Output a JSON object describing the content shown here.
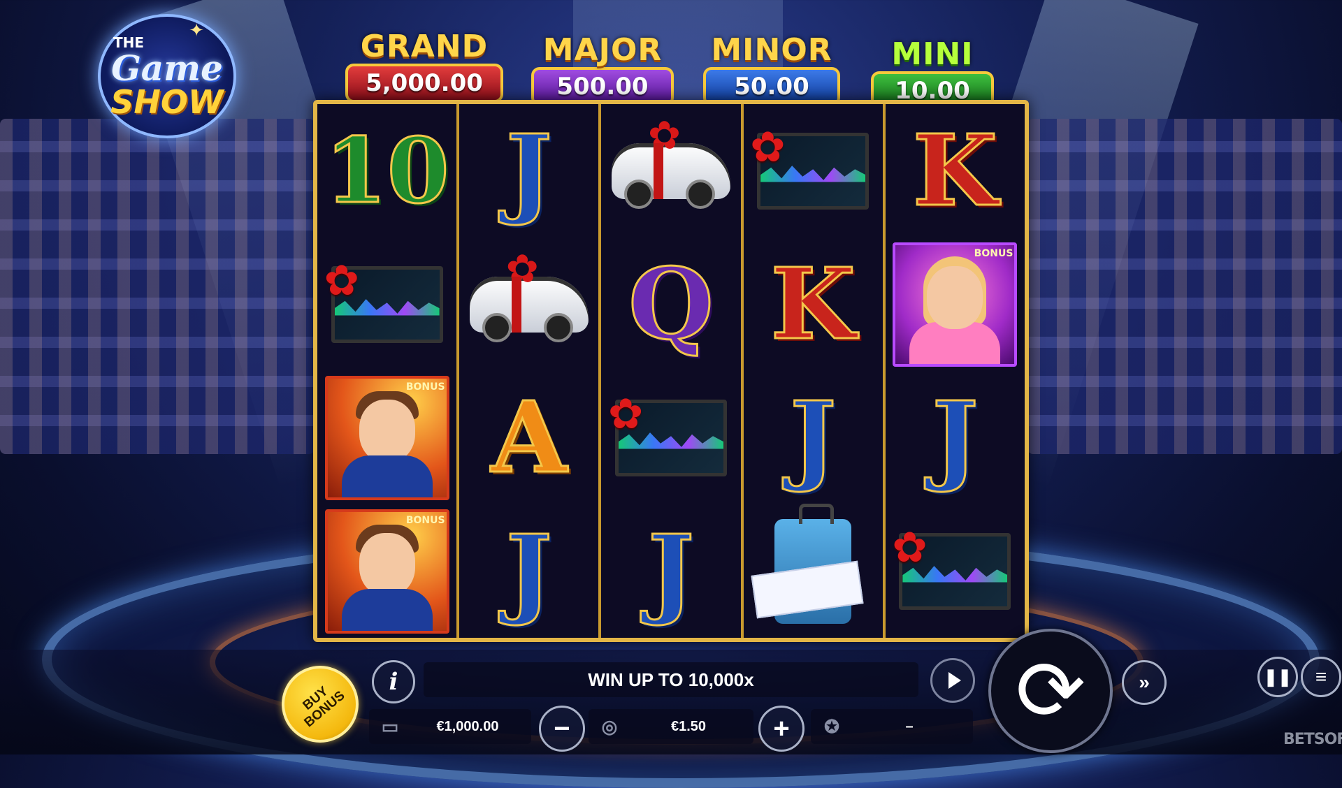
{
  "logo": {
    "the": "THE",
    "game": "Game",
    "show": "SHOW"
  },
  "jackpots": [
    {
      "name": "GRAND",
      "value": "5,000.00",
      "color": "#c91e26"
    },
    {
      "name": "MAJOR",
      "value": "500.00",
      "color": "#7a2bc4"
    },
    {
      "name": "MINOR",
      "value": "50.00",
      "color": "#1f5ccc"
    },
    {
      "name": "MINI",
      "value": "10.00",
      "color": "#1f9a27"
    }
  ],
  "reels": [
    [
      "10",
      "tv-gift",
      "host-bonus",
      "host-bonus"
    ],
    [
      "J",
      "car-gift",
      "A",
      "J"
    ],
    [
      "car-gift",
      "Q",
      "tv-gift",
      "J"
    ],
    [
      "tv-gift",
      "K",
      "J",
      "luggage-ticket"
    ],
    [
      "K",
      "hostess-bonus",
      "J",
      "tv-gift"
    ]
  ],
  "bonus_tag": "BONUS",
  "controls": {
    "buy_bonus": "BUY\nBONUS",
    "info_icon": "i",
    "message": "WIN UP TO 10,000x",
    "balance": "€1,000.00",
    "bet": "€1.50",
    "win": "–",
    "minus": "−",
    "plus": "+",
    "spin_icon": "⟳",
    "turbo_icon": "»",
    "pause_icon": "❚❚",
    "menu_icon": "≡"
  },
  "brand": "BETSOFT"
}
